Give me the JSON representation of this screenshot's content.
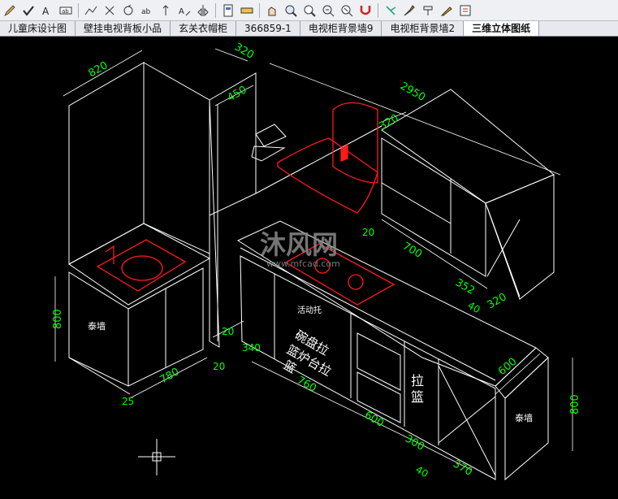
{
  "toolbar": {
    "tools": [
      "pencil-icon",
      "check-icon",
      "text-style-icon",
      "dimension-text-icon",
      "polyline-icon",
      "expand-arrows-icon",
      "rotate-icon",
      "ab-text-icon",
      "height-marker-icon",
      "text-edit-icon",
      "mirror-icon",
      "page-icon",
      "measure-icon",
      "pan-icon",
      "zoom-icon",
      "zoom-window-icon",
      "zoom-extents-icon",
      "zoom-previous-icon",
      "magnet-icon",
      "select-star-icon",
      "brush-icon",
      "paint-icon",
      "fill-icon",
      "edit-doc-icon"
    ]
  },
  "tabs": [
    {
      "label": "儿童床设计图",
      "active": false
    },
    {
      "label": "壁挂电视背板小品",
      "active": false
    },
    {
      "label": "玄关衣帽柜",
      "active": false
    },
    {
      "label": "366859-1",
      "active": false
    },
    {
      "label": "电视柜背景墙9",
      "active": false
    },
    {
      "label": "电视柜背景墙2",
      "active": false
    },
    {
      "label": "三维立体图纸",
      "active": true
    }
  ],
  "drawing": {
    "colors": {
      "lines": "#ffffff",
      "dims": "#00ff00",
      "appliance": "#ff1a1a",
      "background": "#000000"
    },
    "dims": {
      "d820": "820",
      "d320_top": "320",
      "d450": "450",
      "d2950": "2950",
      "d320_hood": "320",
      "d20_a": "20",
      "d700": "700",
      "d352": "352",
      "d40_a": "40",
      "d320_right": "320",
      "d800_left": "800",
      "d780_left": "780",
      "d20_b": "20",
      "d25": "25",
      "d20_c": "20",
      "d340": "340",
      "d760": "760",
      "d600_bottom": "600",
      "d300": "300",
      "d40_b": "40",
      "d370": "370",
      "d600_right": "600",
      "d800_right": "800"
    },
    "labels": {
      "left_cabinet": "泰墙",
      "right_cabinet": "泰墙",
      "shelf_tray": "活动托",
      "bowl_basket": "碗盘拉",
      "stove_basket": "篮炉台拉",
      "basket_end": "篮",
      "pull_basket_1": "拉",
      "pull_basket_2": "篮"
    },
    "watermark": {
      "brand": "沐风网",
      "url": "www.mfcad.com"
    }
  }
}
